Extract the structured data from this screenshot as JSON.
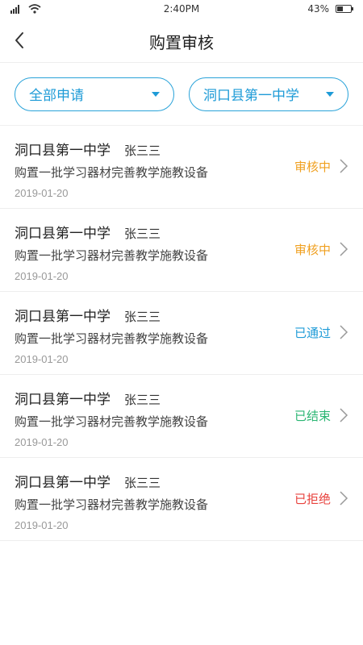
{
  "status_bar": {
    "time": "2:40PM",
    "battery": "43%",
    "battery_level": 0.43,
    "icons": [
      "signal-icon",
      "wifi-icon",
      "battery-icon"
    ]
  },
  "nav": {
    "title": "购置审核",
    "back_icon": "chevron-left-icon"
  },
  "filters": {
    "type_label": "全部申请",
    "school_label": "洞口县第一中学",
    "caret_icon": "caret-down-icon"
  },
  "items": [
    {
      "school": "洞口县第一中学",
      "applicant": "张三三",
      "desc": "购置一批学习器材完善教学施教设备",
      "date": "2019-01-20",
      "status": "审核中",
      "status_color": "#f0a020"
    },
    {
      "school": "洞口县第一中学",
      "applicant": "张三三",
      "desc": "购置一批学习器材完善教学施教设备",
      "date": "2019-01-20",
      "status": "审核中",
      "status_color": "#f0a020"
    },
    {
      "school": "洞口县第一中学",
      "applicant": "张三三",
      "desc": "购置一批学习器材完善教学施教设备",
      "date": "2019-01-20",
      "status": "已通过",
      "status_color": "#1e9bd7"
    },
    {
      "school": "洞口县第一中学",
      "applicant": "张三三",
      "desc": "购置一批学习器材完善教学施教设备",
      "date": "2019-01-20",
      "status": "已结束",
      "status_color": "#2bb673"
    },
    {
      "school": "洞口县第一中学",
      "applicant": "张三三",
      "desc": "购置一批学习器材完善教学施教设备",
      "date": "2019-01-20",
      "status": "已拒绝",
      "status_color": "#e8413c"
    }
  ],
  "colors": {
    "accent": "#1e9bd7",
    "divider": "#eeeeee"
  }
}
